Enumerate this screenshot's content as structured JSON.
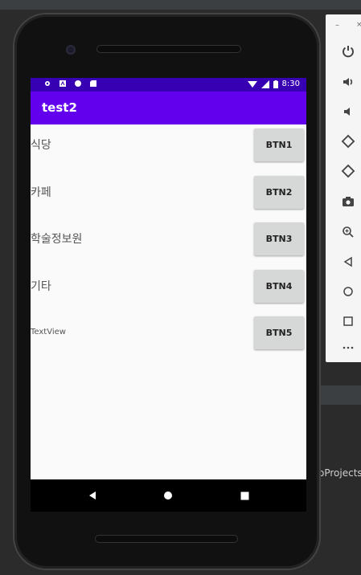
{
  "app": {
    "title": "test2"
  },
  "status_bar": {
    "time": "8:30"
  },
  "rows": [
    {
      "label": "식당",
      "button": "BTN1"
    },
    {
      "label": "카페",
      "button": "BTN2"
    },
    {
      "label": "학술정보원",
      "button": "BTN3"
    },
    {
      "label": "기타",
      "button": "BTN4"
    },
    {
      "label": "TextView",
      "button": "BTN5"
    }
  ],
  "ide": {
    "projects_text": "oProjects"
  },
  "colors": {
    "status_bar": "#3700b3",
    "app_bar": "#6200ee",
    "button": "#d6d7d7",
    "screen_bg": "#fafafa"
  },
  "toolbar_icons": [
    "power-icon",
    "volume-up-icon",
    "volume-down-icon",
    "rotate-left-icon",
    "rotate-right-icon",
    "camera-icon",
    "zoom-icon",
    "back-icon",
    "home-icon",
    "overview-icon",
    "more-icon"
  ]
}
